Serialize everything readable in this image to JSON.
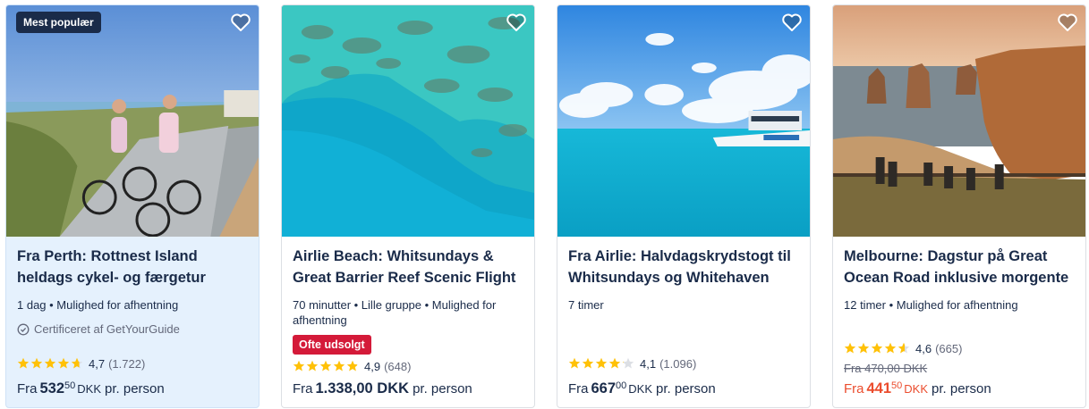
{
  "cards": [
    {
      "badge": "Mest populær",
      "title": "Fra Perth: Rottnest Island heldags cykel- og færgetur",
      "meta": "1 dag • Mulighed for afhentning",
      "certified": "Certificeret af GetYourGuide",
      "rating": 4.7,
      "rating_text": "4,7",
      "reviews": "(1.722)",
      "price_from": "Fra",
      "price_main": "532",
      "price_cents": "50",
      "price_currency": "DKK",
      "price_suffix": "pr. person"
    },
    {
      "title": "Airlie Beach: Whitsundays & Great Barrier Reef Scenic Flight",
      "meta": "70 minutter • Lille gruppe • Mulighed for afhentning",
      "tag": "Ofte udsolgt",
      "rating": 4.9,
      "rating_text": "4,9",
      "reviews": "(648)",
      "price_from": "Fra",
      "price_main": "1.338,00 DKK",
      "price_suffix": "pr. person"
    },
    {
      "title": "Fra Airlie: Halvdagskrydstogt til Whitsundays og Whitehaven",
      "meta": "7 timer",
      "rating": 4.1,
      "rating_text": "4,1",
      "reviews": "(1.096)",
      "price_from": "Fra",
      "price_main": "667",
      "price_cents": "00",
      "price_currency": "DKK",
      "price_suffix": "pr. person"
    },
    {
      "title": "Melbourne: Dagstur på Great Ocean Road inklusive morgente",
      "meta": "12 timer • Mulighed for afhentning",
      "rating": 4.6,
      "rating_text": "4,6",
      "reviews": "(665)",
      "old_price": "Fra 470,00 DKK",
      "price_from": "Fra",
      "price_main": "441",
      "price_cents": "50",
      "price_currency": "DKK",
      "price_suffix": "pr. person"
    }
  ],
  "icons": {
    "wishlist": "heart-outline-icon",
    "certified": "check-circle-icon",
    "star": "star-icon"
  },
  "colors": {
    "navy": "#1a2b49",
    "star": "#ffc107",
    "sale": "#eb4d2e",
    "sellout": "#d41a39",
    "highlight": "#e5f1fd"
  }
}
